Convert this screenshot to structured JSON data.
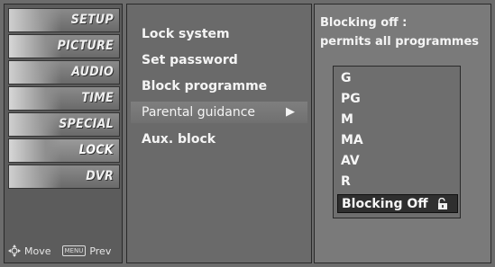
{
  "sidebar": {
    "items": [
      {
        "label": "SETUP"
      },
      {
        "label": "PICTURE"
      },
      {
        "label": "AUDIO"
      },
      {
        "label": "TIME"
      },
      {
        "label": "SPECIAL"
      },
      {
        "label": "LOCK"
      },
      {
        "label": "DVR"
      }
    ],
    "active_index": 5,
    "footer": {
      "move": "Move",
      "prev_key": "MENU",
      "prev": "Prev"
    }
  },
  "lock_menu": {
    "options": [
      {
        "label": "Lock system"
      },
      {
        "label": "Set password"
      },
      {
        "label": "Block programme"
      },
      {
        "label": "Parental guidance",
        "has_submenu": true
      },
      {
        "label": "Aux. block"
      }
    ],
    "selected_index": 3,
    "arrow": "▶"
  },
  "parental_panel": {
    "description_line1": "Blocking off :",
    "description_line2": "permits all programmes",
    "ratings": [
      "G",
      "PG",
      "M",
      "MA",
      "AV",
      "R",
      "Blocking Off"
    ],
    "selected_index": 6
  },
  "colors": {
    "background": "#6c6c6c",
    "selected_row": "#2f2f2f",
    "text": "#f4f4f4"
  }
}
